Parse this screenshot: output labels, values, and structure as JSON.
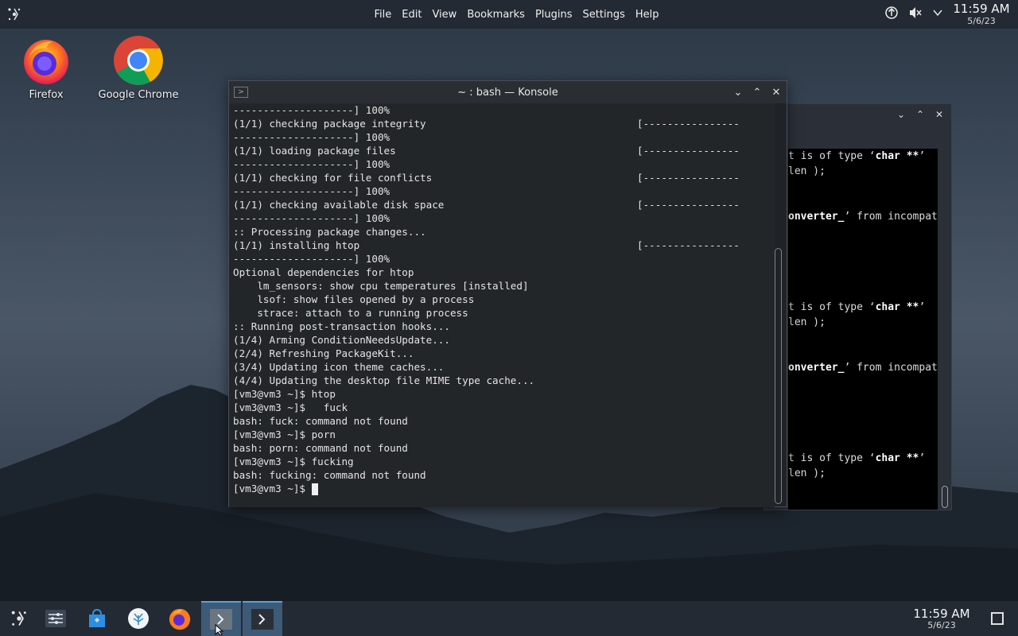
{
  "top_panel": {
    "menu": [
      "File",
      "Edit",
      "View",
      "Bookmarks",
      "Plugins",
      "Settings",
      "Help"
    ],
    "clock_time": "11:59 AM",
    "clock_date": "5/6/23",
    "tray_icons": [
      "update-icon",
      "volume-muted-icon",
      "chevron-down-icon"
    ]
  },
  "desktop": {
    "icons": [
      {
        "label": "Firefox",
        "icon": "firefox-icon"
      },
      {
        "label": "Google Chrome",
        "icon": "chrome-icon"
      }
    ]
  },
  "konsole": {
    "title": "~ : bash — Konsole",
    "lines": [
      "--------------------] 100%",
      "(1/1) checking package integrity                                   [----------------",
      "--------------------] 100%",
      "(1/1) loading package files                                        [----------------",
      "--------------------] 100%",
      "(1/1) checking for file conflicts                                  [----------------",
      "--------------------] 100%",
      "(1/1) checking available disk space                                [----------------",
      "--------------------] 100%",
      ":: Processing package changes...",
      "(1/1) installing htop                                              [----------------",
      "--------------------] 100%",
      "Optional dependencies for htop",
      "    lm_sensors: show cpu temperatures [installed]",
      "    lsof: show files opened by a process",
      "    strace: attach to a running process",
      ":: Running post-transaction hooks...",
      "(1/4) Arming ConditionNeedsUpdate...",
      "(2/4) Refreshing PackageKit...",
      "(3/4) Updating icon theme caches...",
      "(4/4) Updating the desktop file MIME type cache...",
      "[vm3@vm3 ~]$ htop",
      "[vm3@vm3 ~]$   fuck",
      "bash: fuck: command not found",
      "[vm3@vm3 ~]$ porn",
      "bash: porn: command not found",
      "[vm3@vm3 ~]$ fucking",
      "bash: fucking: command not found"
    ],
    "prompt": "[vm3@vm3 ~]$ "
  },
  "bg_window": {
    "lines": [
      {
        "pre": "t is of type ‘",
        "bold": "char **",
        "post": "’"
      },
      {
        "pre": "len );",
        "bold": "",
        "post": ""
      },
      {
        "pre": "",
        "bold": "onverter_",
        "post": "’ from incompat"
      },
      {
        "pre": "t is of type ‘",
        "bold": "char **",
        "post": "’"
      },
      {
        "pre": "len );",
        "bold": "",
        "post": ""
      },
      {
        "pre": "",
        "bold": "onverter_",
        "post": "’ from incompat"
      },
      {
        "pre": "t is of type ‘",
        "bold": "char **",
        "post": "’"
      },
      {
        "pre": "len );",
        "bold": "",
        "post": ""
      }
    ]
  },
  "taskbar": {
    "items": [
      "app-launcher-icon",
      "system-settings-icon",
      "discover-store-icon",
      "plasma-icon",
      "firefox-icon",
      "konsole-icon",
      "konsole-icon"
    ],
    "clock_time": "11:59 AM",
    "clock_date": "5/6/23"
  }
}
